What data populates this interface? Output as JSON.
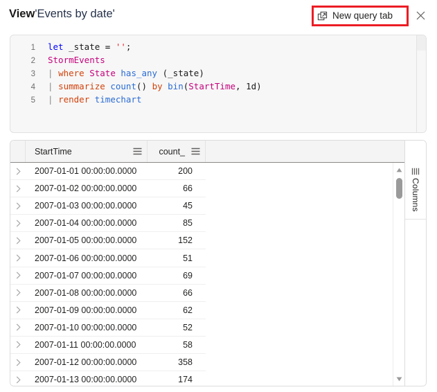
{
  "header": {
    "title_prefix": "View",
    "title_name": "'Events by date'",
    "new_query_tab_label": "New query tab",
    "new_query_tab_icon": "open-in-new-tab-icon",
    "close_icon": "close-icon",
    "highlight_color": "#ec1c24"
  },
  "editor": {
    "line_numbers": [
      "1",
      "2",
      "3",
      "4",
      "5"
    ],
    "lines": [
      "let _state = '';",
      "StormEvents",
      "| where State has_any (_state)",
      "| summarize count() by bin(StartTime, 1d)",
      "| render timechart"
    ],
    "tokens": [
      [
        {
          "t": "let",
          "c": "tk-kw"
        },
        {
          "t": " ",
          "c": "tk-plain"
        },
        {
          "t": "_state",
          "c": "tk-var"
        },
        {
          "t": " ",
          "c": "tk-plain"
        },
        {
          "t": "=",
          "c": "tk-op"
        },
        {
          "t": " ",
          "c": "tk-plain"
        },
        {
          "t": "''",
          "c": "tk-str"
        },
        {
          "t": ";",
          "c": "tk-plain"
        }
      ],
      [
        {
          "t": "StormEvents",
          "c": "tk-tbl"
        }
      ],
      [
        {
          "t": "| ",
          "c": "tk-pipe"
        },
        {
          "t": "where",
          "c": "tk-cmd"
        },
        {
          "t": " ",
          "c": "tk-plain"
        },
        {
          "t": "State",
          "c": "tk-col"
        },
        {
          "t": " ",
          "c": "tk-plain"
        },
        {
          "t": "has_any",
          "c": "tk-fn"
        },
        {
          "t": " (",
          "c": "tk-plain"
        },
        {
          "t": "_state",
          "c": "tk-var"
        },
        {
          "t": ")",
          "c": "tk-plain"
        }
      ],
      [
        {
          "t": "| ",
          "c": "tk-pipe"
        },
        {
          "t": "summarize",
          "c": "tk-cmd"
        },
        {
          "t": " ",
          "c": "tk-plain"
        },
        {
          "t": "count",
          "c": "tk-fn"
        },
        {
          "t": "()",
          "c": "tk-plain"
        },
        {
          "t": " ",
          "c": "tk-plain"
        },
        {
          "t": "by",
          "c": "tk-cmd"
        },
        {
          "t": " ",
          "c": "tk-plain"
        },
        {
          "t": "bin",
          "c": "tk-fn"
        },
        {
          "t": "(",
          "c": "tk-plain"
        },
        {
          "t": "StartTime",
          "c": "tk-col"
        },
        {
          "t": ", ",
          "c": "tk-plain"
        },
        {
          "t": "1d",
          "c": "tk-num"
        },
        {
          "t": ")",
          "c": "tk-plain"
        }
      ],
      [
        {
          "t": "| ",
          "c": "tk-pipe"
        },
        {
          "t": "render",
          "c": "tk-cmd"
        },
        {
          "t": " ",
          "c": "tk-plain"
        },
        {
          "t": "timechart",
          "c": "tk-fn"
        }
      ]
    ]
  },
  "grid": {
    "columns": [
      {
        "label": "StartTime",
        "menu_icon": "column-menu-icon",
        "align": "left"
      },
      {
        "label": "count_",
        "menu_icon": "column-menu-icon",
        "align": "right"
      }
    ],
    "rows": [
      {
        "StartTime": "2007-01-01 00:00:00.0000",
        "count_": "200"
      },
      {
        "StartTime": "2007-01-02 00:00:00.0000",
        "count_": "66"
      },
      {
        "StartTime": "2007-01-03 00:00:00.0000",
        "count_": "45"
      },
      {
        "StartTime": "2007-01-04 00:00:00.0000",
        "count_": "85"
      },
      {
        "StartTime": "2007-01-05 00:00:00.0000",
        "count_": "152"
      },
      {
        "StartTime": "2007-01-06 00:00:00.0000",
        "count_": "51"
      },
      {
        "StartTime": "2007-01-07 00:00:00.0000",
        "count_": "69"
      },
      {
        "StartTime": "2007-01-08 00:00:00.0000",
        "count_": "66"
      },
      {
        "StartTime": "2007-01-09 00:00:00.0000",
        "count_": "62"
      },
      {
        "StartTime": "2007-01-10 00:00:00.0000",
        "count_": "52"
      },
      {
        "StartTime": "2007-01-11 00:00:00.0000",
        "count_": "58"
      },
      {
        "StartTime": "2007-01-12 00:00:00.0000",
        "count_": "358"
      },
      {
        "StartTime": "2007-01-13 00:00:00.0000",
        "count_": "174"
      }
    ],
    "row_expand_icon": "chevron-right-icon",
    "scrollbar": {
      "up_icon": "caret-up-icon",
      "down_icon": "caret-down-icon"
    }
  },
  "columns_panel": {
    "label": "Columns",
    "icon": "columns-icon"
  }
}
